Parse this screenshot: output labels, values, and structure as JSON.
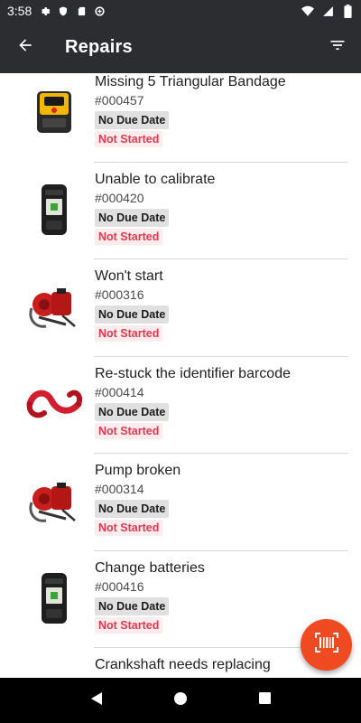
{
  "status_bar": {
    "time": "3:58",
    "icons_left": [
      "gear-icon",
      "shield-icon",
      "sd-card-icon",
      "data-saver-icon"
    ],
    "icons_right": [
      "wifi-icon",
      "signal-icon",
      "battery-icon"
    ]
  },
  "app_bar": {
    "title": "Repairs",
    "back_icon": "arrow-left-icon",
    "filter_icon": "filter-icon"
  },
  "repairs": [
    {
      "title": "Missing 5 Triangular Bandage",
      "code": "#000457",
      "due": "No Due Date",
      "status": "Not Started",
      "image": "aed-device"
    },
    {
      "title": "Unable to calibrate",
      "code": "#000420",
      "due": "No Due Date",
      "status": "Not Started",
      "image": "gas-detector"
    },
    {
      "title": "Won't start",
      "code": "#000316",
      "due": "No Due Date",
      "status": "Not Started",
      "image": "portable-pump"
    },
    {
      "title": "Re-stuck the identifier barcode",
      "code": "#000414",
      "due": "No Due Date",
      "status": "Not Started",
      "image": "lifting-sling"
    },
    {
      "title": "Pump broken",
      "code": "#000314",
      "due": "No Due Date",
      "status": "Not Started",
      "image": "portable-pump"
    },
    {
      "title": "Change batteries",
      "code": "#000416",
      "due": "No Due Date",
      "status": "Not Started",
      "image": "gas-detector"
    },
    {
      "title": "Crankshaft needs replacing",
      "code": "",
      "due": "",
      "status": "",
      "image": ""
    }
  ],
  "fab": {
    "icon": "barcode-scan-icon"
  },
  "nav_bar": {
    "buttons": [
      "back-triangle-icon",
      "home-circle-icon",
      "recents-square-icon"
    ]
  },
  "colors": {
    "app_bar": "#2b2d31",
    "status_text": "#e0394d",
    "status_bg": "#fdeced",
    "due_bg": "#e0e0e0",
    "fab": "#f04a23"
  }
}
